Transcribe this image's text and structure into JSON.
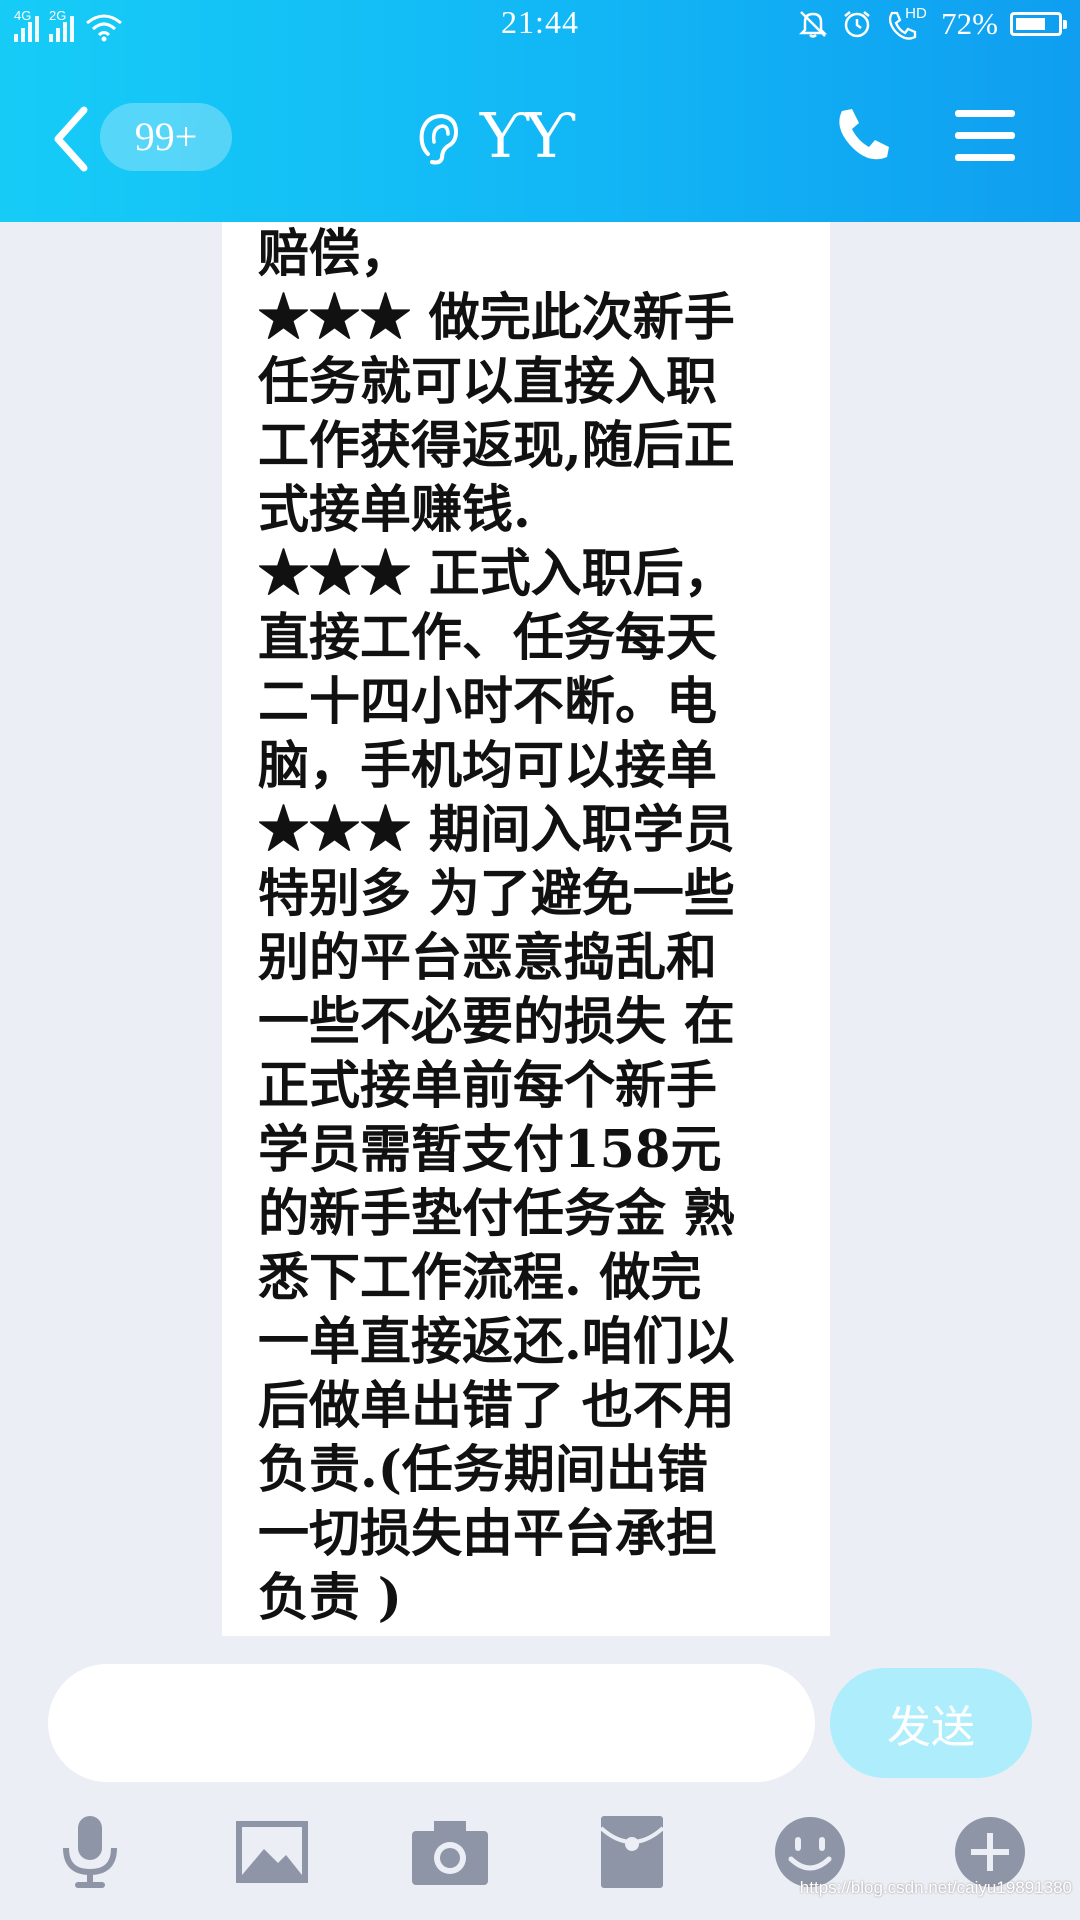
{
  "status_bar": {
    "signal1_label": "4G",
    "signal2_label": "2G",
    "time": "21:44",
    "hd_label": "HD",
    "battery_percent": "72%",
    "battery_level": 0.72,
    "icons": [
      "wifi-icon",
      "alarm-bell-icon",
      "clock-icon",
      "phone-hd-icon",
      "battery-icon"
    ]
  },
  "header": {
    "unread_badge": "99+",
    "title": "ƳƳ",
    "icons": [
      "back-arrow-icon",
      "ear-icon",
      "phone-icon",
      "menu-icon"
    ]
  },
  "message": {
    "lines": [
      "赔偿，",
      "★★★ 做完此次新手",
      "任务就可以直接入职",
      "工作获得返现,随后正",
      "式接单赚钱.",
      "★★★ 正式入职后，",
      "直接工作、任务每天",
      "二十四小时不断。电",
      "脑，手机均可以接单",
      "★★★ 期间入职学员",
      "特别多 为了避免一些",
      "别的平台恶意捣乱和",
      "一些不必要的损失 在",
      "正式接单前每个新手",
      "学员需暂支付158元",
      "的新手垫付任务金 熟",
      "悉下工作流程. 做完",
      "一单直接返还.咱们以",
      "后做单出错了 也不用",
      "负责.(任务期间出错",
      "一切损失由平台承担",
      "负责 )"
    ]
  },
  "input": {
    "placeholder": "",
    "send_label": "发送"
  },
  "toolbar": {
    "icons": [
      "microphone-icon",
      "image-icon",
      "camera-icon",
      "red-packet-icon",
      "emoji-icon",
      "plus-icon"
    ]
  },
  "watermark": "https://blog.csdn.net/caiyu19891380",
  "colors": {
    "header_start": "#16ccf7",
    "header_end": "#0f9ef0",
    "send_button": "#aeeefc",
    "toolbar_icon": "#8e95a6",
    "background": "#eceef5"
  }
}
